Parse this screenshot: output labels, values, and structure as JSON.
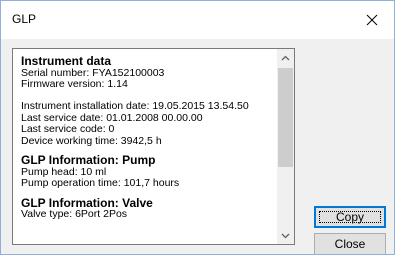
{
  "window": {
    "title": "GLP",
    "close_icon": "close-icon"
  },
  "content": {
    "instrument_heading": "Instrument data",
    "serial_number": "Serial number: FYA152100003",
    "firmware": "Firmware version: 1.14",
    "installation_date": "Instrument installation date: 19.05.2015 13.54.50",
    "last_service_date": "Last service date: 01.01.2008 00.00.00",
    "last_service_code": "Last service code: 0",
    "working_time": "Device working time: 3942,5 h",
    "pump_heading": "GLP Information: Pump",
    "pump_head": "Pump head: 10 ml",
    "pump_operation_time": "Pump operation time: 101,7 hours",
    "valve_heading": "GLP Information: Valve",
    "valve_type": "Valve type: 6Port 2Pos"
  },
  "buttons": {
    "copy": "Copy",
    "close": "Close"
  },
  "scroll_position": 0.0,
  "colors": {
    "window_border": "#8fb1d6",
    "default_button_border": "#0078d7",
    "button_face": "#e1e1e1",
    "dialog_bg": "#f0f0f0"
  }
}
